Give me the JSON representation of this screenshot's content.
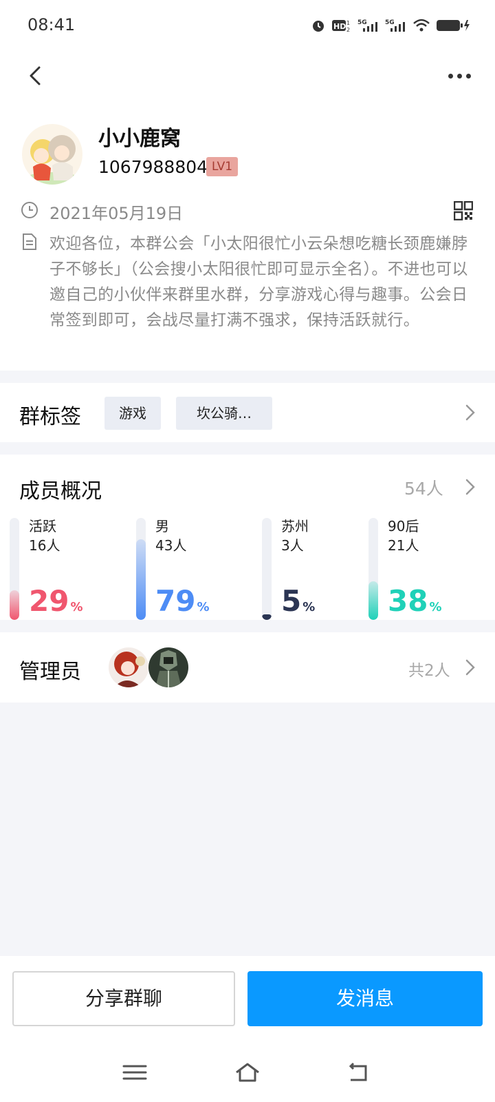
{
  "status_bar": {
    "time": "08:41"
  },
  "group": {
    "name": "小小鹿窝",
    "id": "1067988804",
    "level": "LV1",
    "created": "2021年05月19日",
    "intro": "欢迎各位，本群公会「小太阳很忙小云朵想吃糖长颈鹿嫌脖子不够长」（公会搜小太阳很忙即可显示全名）。不进也可以邀自己的小伙伴来群里水群，分享游戏心得与趣事。公会日常签到即可，会战尽量打满不强求，保持活跃就行。"
  },
  "tags": {
    "title": "群标签",
    "items": [
      "游戏",
      "坎公骑…"
    ]
  },
  "members": {
    "title": "成员概况",
    "count": "54人",
    "stats": [
      {
        "label": "活跃",
        "sub": "16人",
        "pct": "29",
        "value": 0.29,
        "color": "#f0566e"
      },
      {
        "label": "男",
        "sub": "43人",
        "pct": "79",
        "value": 0.79,
        "color": "#4d8cf5"
      },
      {
        "label": "苏州",
        "sub": "3人",
        "pct": "5",
        "value": 0.05,
        "color": "#2b3553"
      },
      {
        "label": "90后",
        "sub": "21人",
        "pct": "38",
        "value": 0.38,
        "color": "#1fd1b8"
      }
    ],
    "pct_sign": "%"
  },
  "admins": {
    "title": "管理员",
    "count": "共2人"
  },
  "actions": {
    "share": "分享群聊",
    "send": "发消息"
  }
}
